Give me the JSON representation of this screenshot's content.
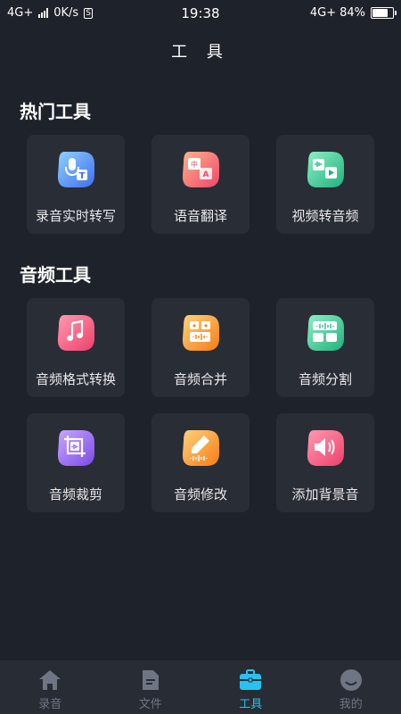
{
  "status_bar": {
    "network": "4G+",
    "speed": "0K/s",
    "time": "19:38",
    "network_right": "4G+",
    "battery": "84%",
    "battery_level": 0.84
  },
  "page": {
    "title": "工 具"
  },
  "sections": {
    "hot": {
      "title": "热门工具",
      "items": [
        {
          "label": "录音实时转写",
          "icon": "voice-to-text-icon"
        },
        {
          "label": "语音翻译",
          "icon": "translate-icon"
        },
        {
          "label": "视频转音频",
          "icon": "video-to-audio-icon"
        }
      ]
    },
    "audio": {
      "title": "音频工具",
      "items": [
        {
          "label": "音频格式转换",
          "icon": "music-note-icon"
        },
        {
          "label": "音频合并",
          "icon": "merge-icon"
        },
        {
          "label": "音频分割",
          "icon": "split-icon"
        },
        {
          "label": "音频裁剪",
          "icon": "crop-icon"
        },
        {
          "label": "音频修改",
          "icon": "edit-pencil-icon"
        },
        {
          "label": "添加背景音",
          "icon": "speaker-icon"
        }
      ]
    }
  },
  "tabbar": {
    "tabs": [
      {
        "label": "录音",
        "icon": "home-icon"
      },
      {
        "label": "文件",
        "icon": "document-icon"
      },
      {
        "label": "工具",
        "icon": "toolbox-icon"
      },
      {
        "label": "我的",
        "icon": "profile-face-icon"
      }
    ],
    "active_index": 2
  },
  "colors": {
    "background": "#1e222a",
    "card": "#292d36",
    "accent": "#29c2ee",
    "tab_inactive": "#6f7582"
  }
}
